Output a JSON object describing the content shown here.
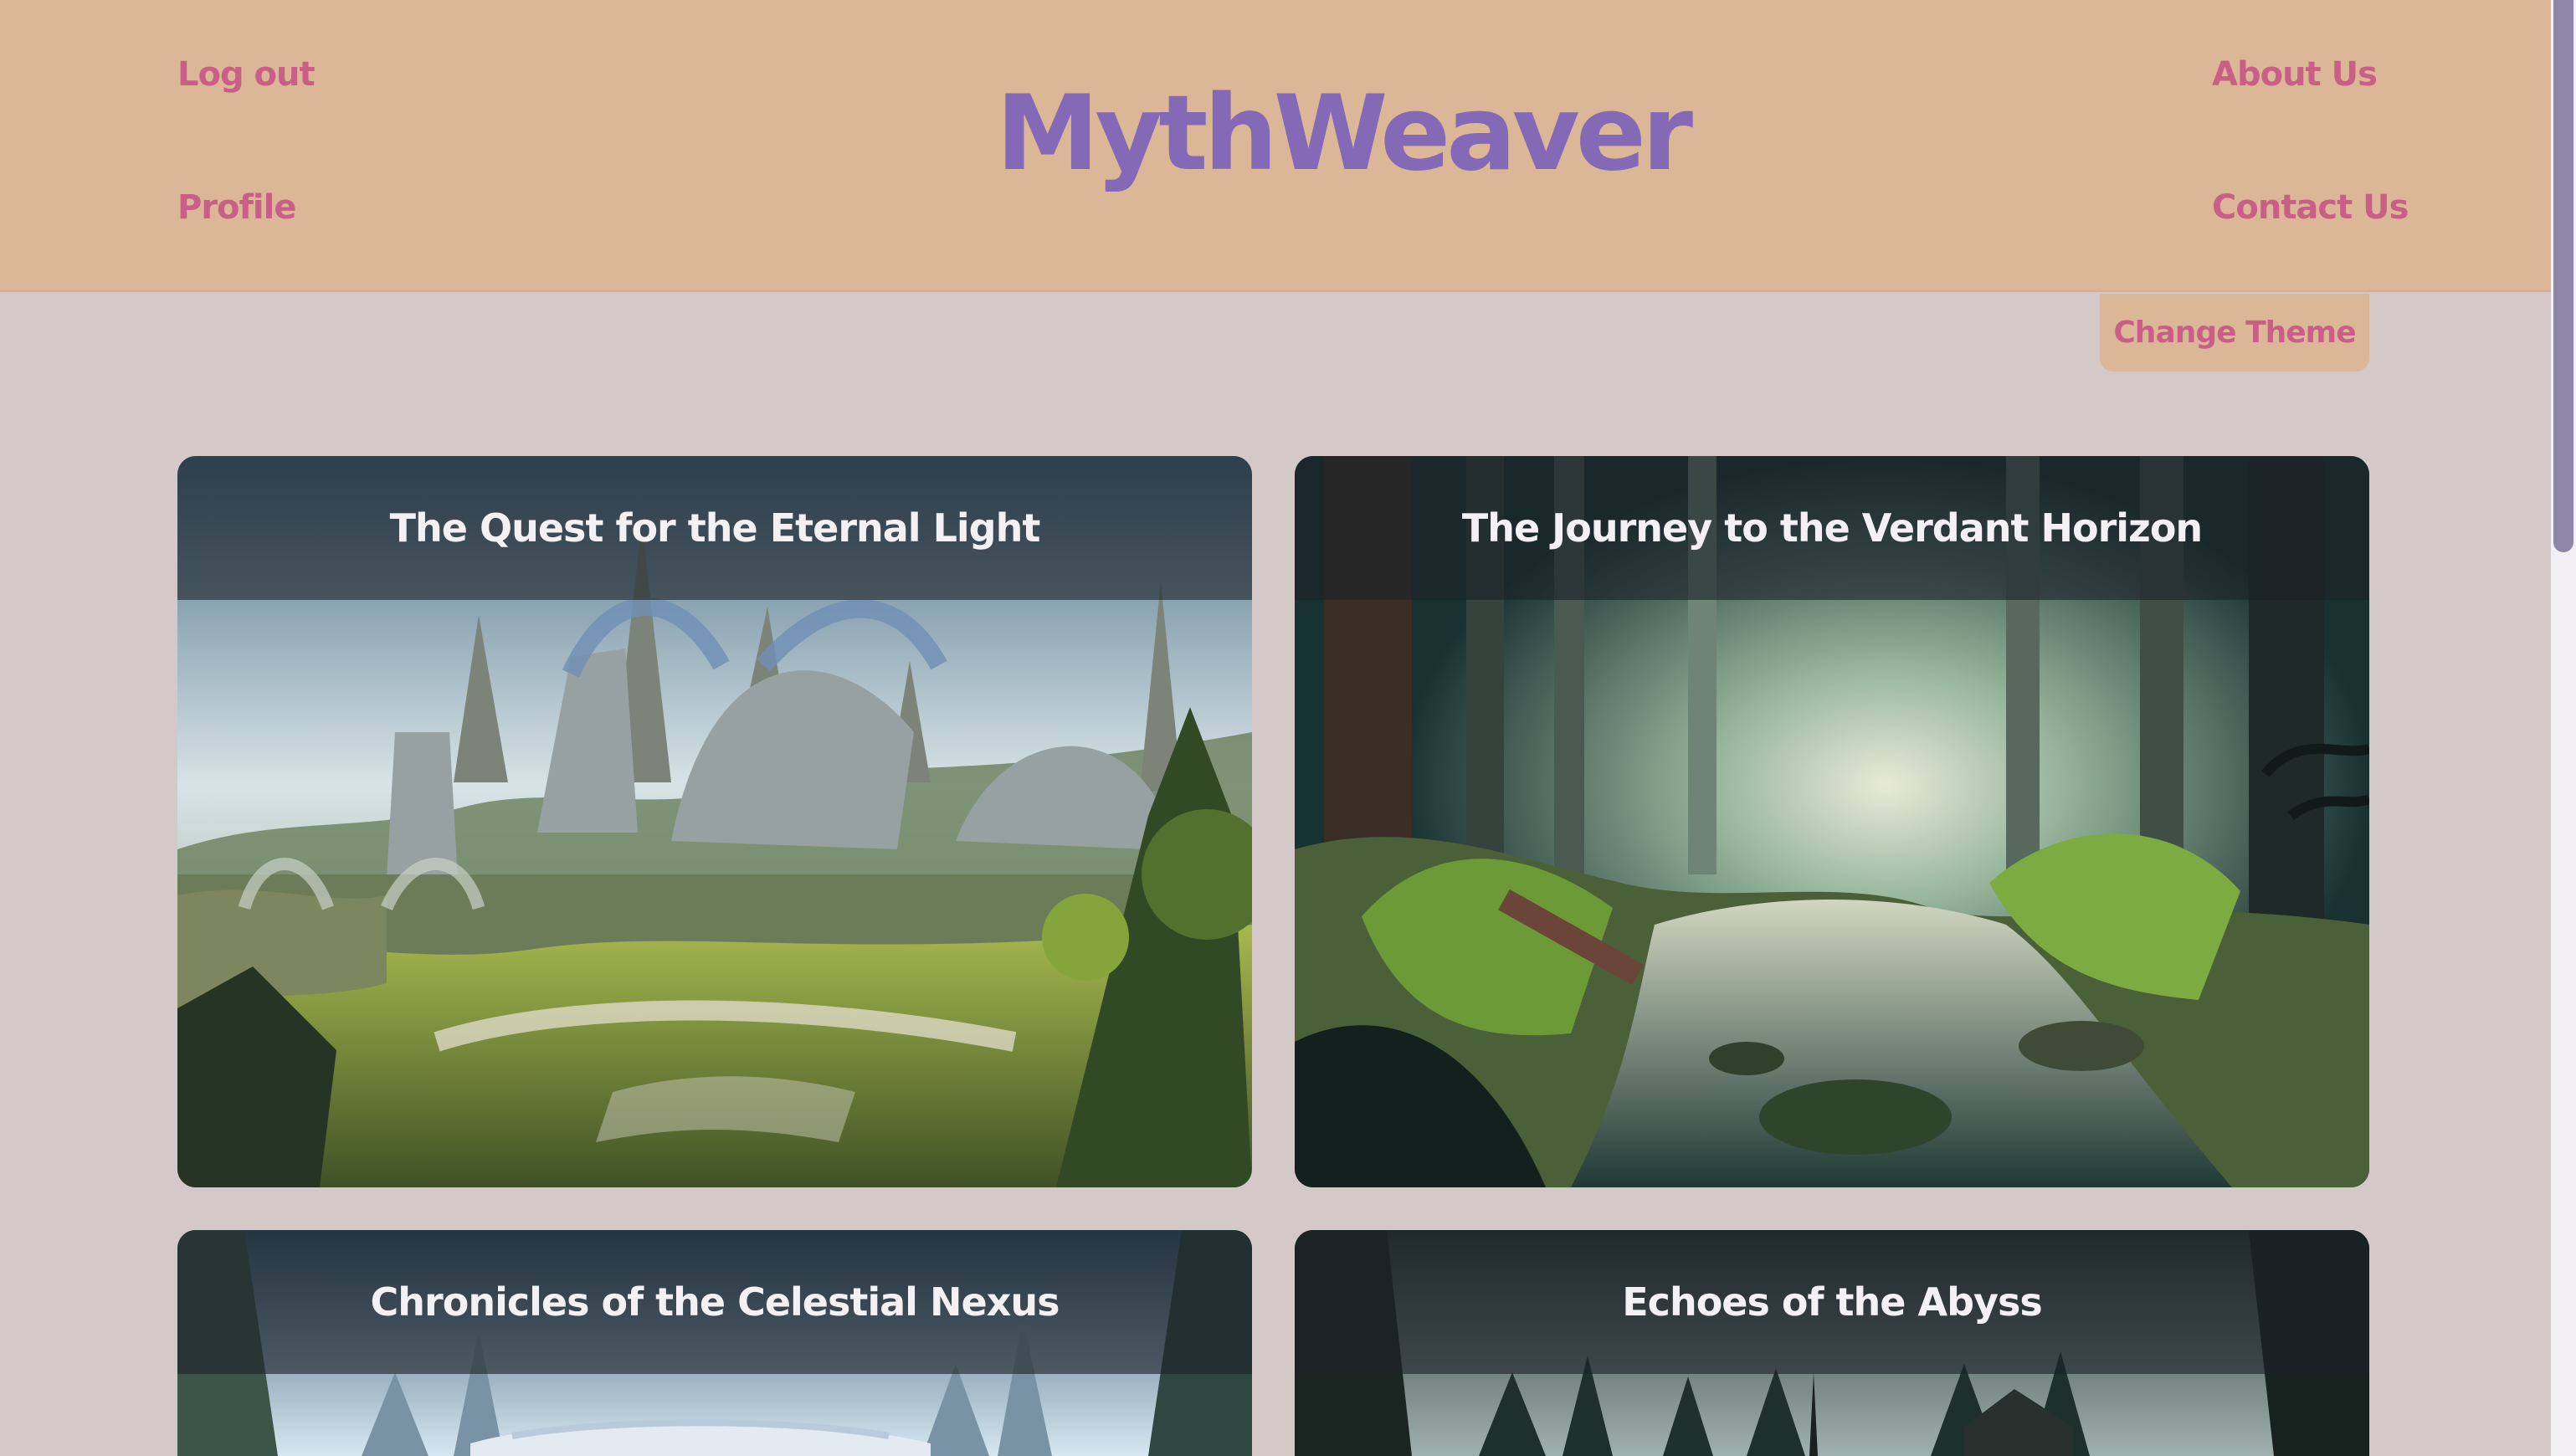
{
  "header": {
    "logo": "MythWeaver",
    "left_links": [
      "Log out",
      "Profile"
    ],
    "right_links": [
      "About Us",
      "Contact Us"
    ]
  },
  "theme_button": {
    "label": "Change Theme"
  },
  "cards": [
    {
      "title": "The Quest for the Eternal Light"
    },
    {
      "title": "The Journey to the Verdant Horizon"
    },
    {
      "title": "Chronicles of the Celestial Nexus"
    },
    {
      "title": "Echoes of the Abyss"
    }
  ],
  "colors": {
    "header_bg": "#dbb797",
    "page_bg": "#d5c8c8",
    "link": "#c95f86",
    "logo": "#8469b7"
  }
}
